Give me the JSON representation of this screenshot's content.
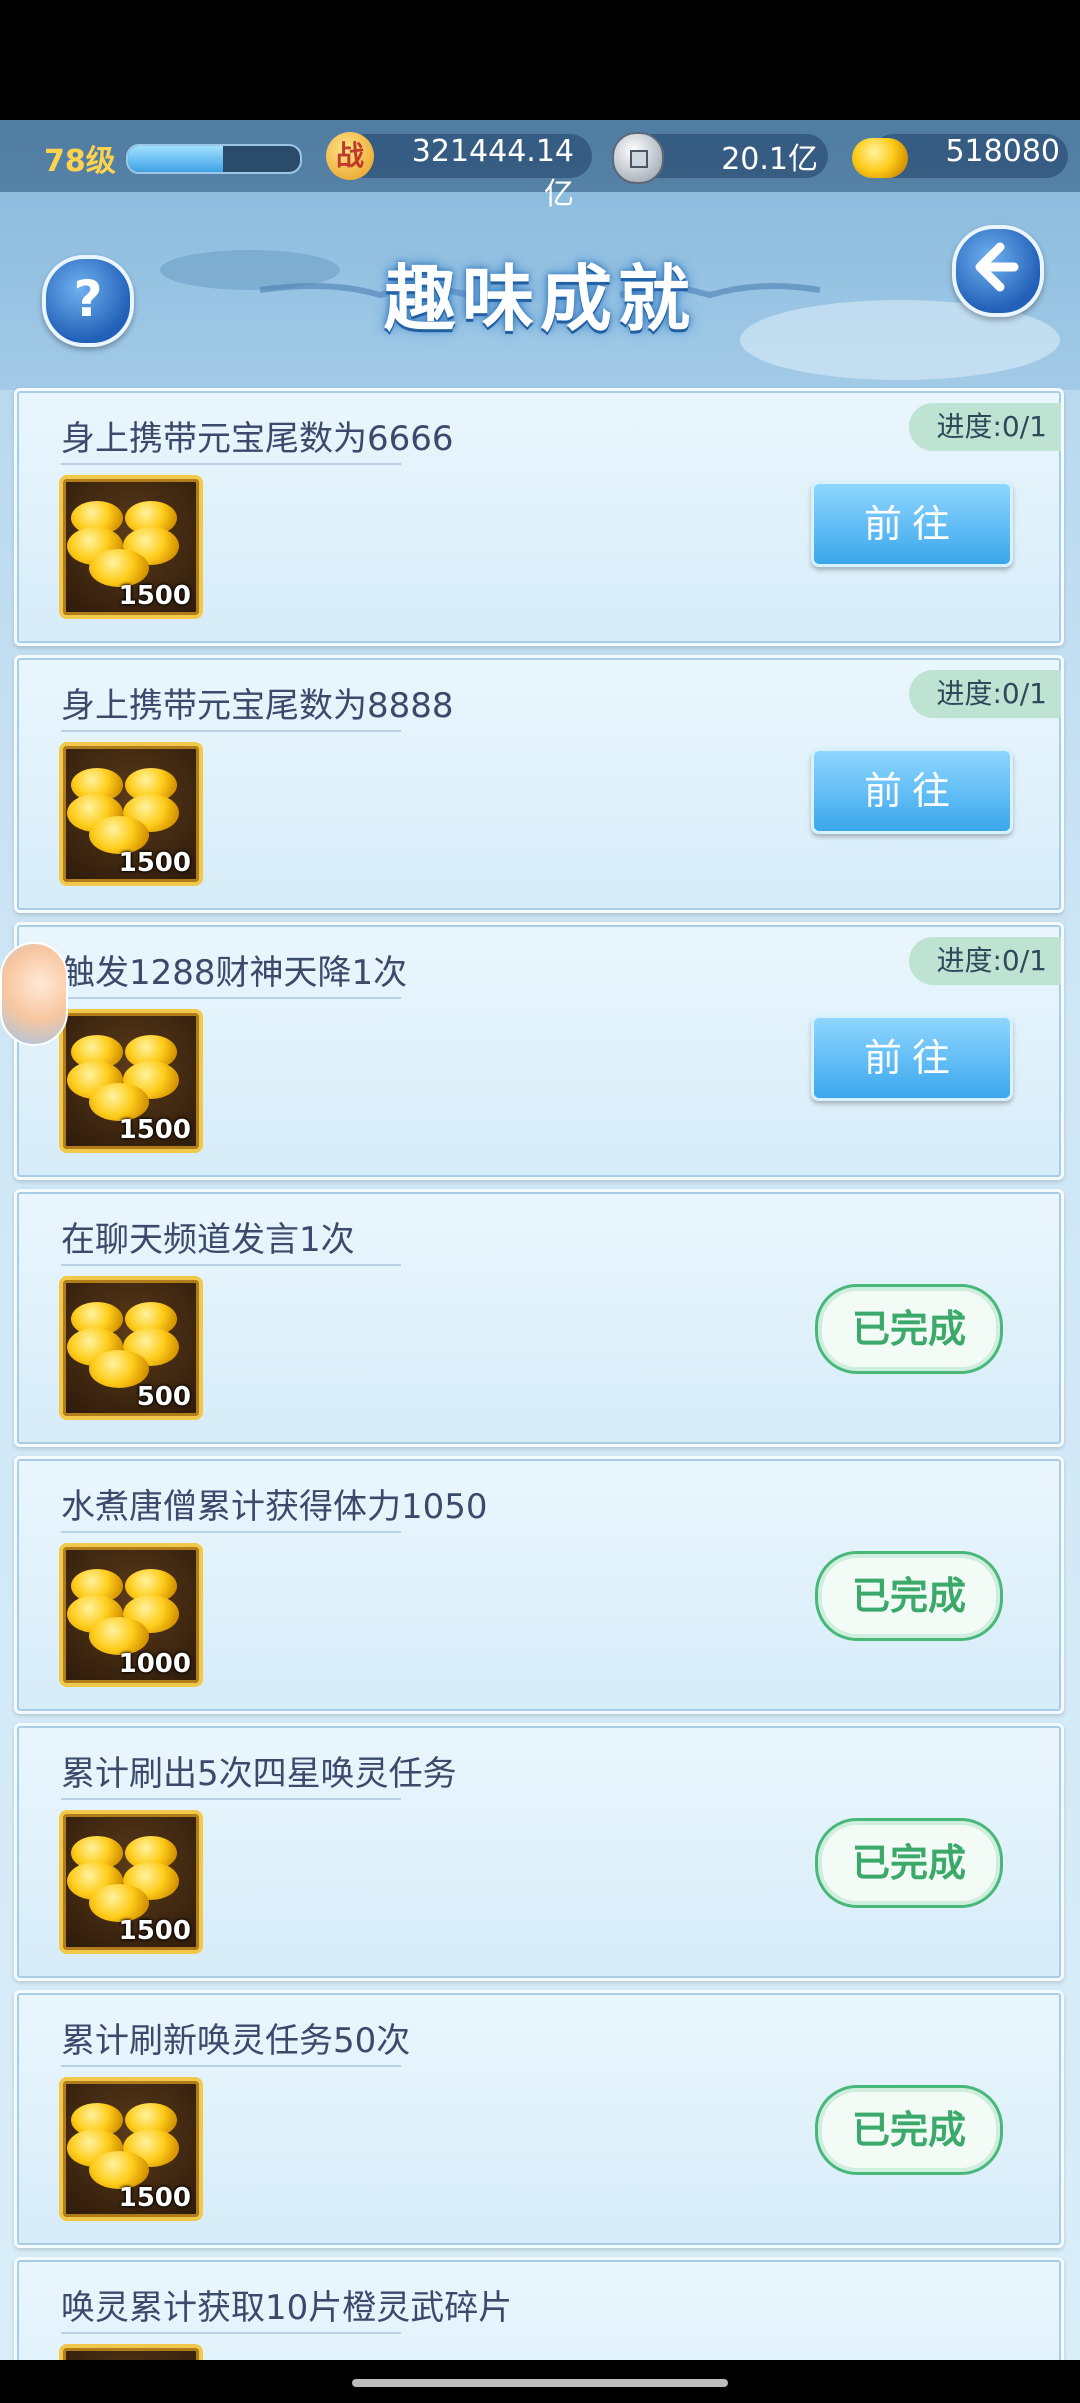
{
  "resources": {
    "level": "78级",
    "xp_fraction": 0.55,
    "power_label": "战",
    "power": "321444.14亿",
    "coins": "20.1亿",
    "gold": "518080"
  },
  "header": {
    "title": "趣味成就",
    "help_label": "?",
    "back_label": "<"
  },
  "achievements": [
    {
      "title": "身上携带元宝尾数为6666",
      "reward": "1500",
      "progress": "进度:0/1",
      "action": "前往"
    },
    {
      "title": "身上携带元宝尾数为8888",
      "reward": "1500",
      "progress": "进度:0/1",
      "action": "前往"
    },
    {
      "title": "触发1288财神天降1次",
      "reward": "1500",
      "progress": "进度:0/1",
      "action": "前往"
    },
    {
      "title": "在聊天频道发言1次",
      "reward": "500",
      "action": "已完成"
    },
    {
      "title": "水煮唐僧累计获得体力1050",
      "reward": "1000",
      "action": "已完成"
    },
    {
      "title": "累计刷出5次四星唤灵任务",
      "reward": "1500",
      "action": "已完成"
    },
    {
      "title": "累计刷新唤灵任务50次",
      "reward": "1500",
      "action": "已完成"
    },
    {
      "title": "唤灵累计获取10片橙灵武碎片",
      "reward": "",
      "action": ""
    }
  ],
  "colors": {
    "accent_blue": "#3aa7ec",
    "done_green": "#3aa96a",
    "gold": "#ffcc1a"
  }
}
